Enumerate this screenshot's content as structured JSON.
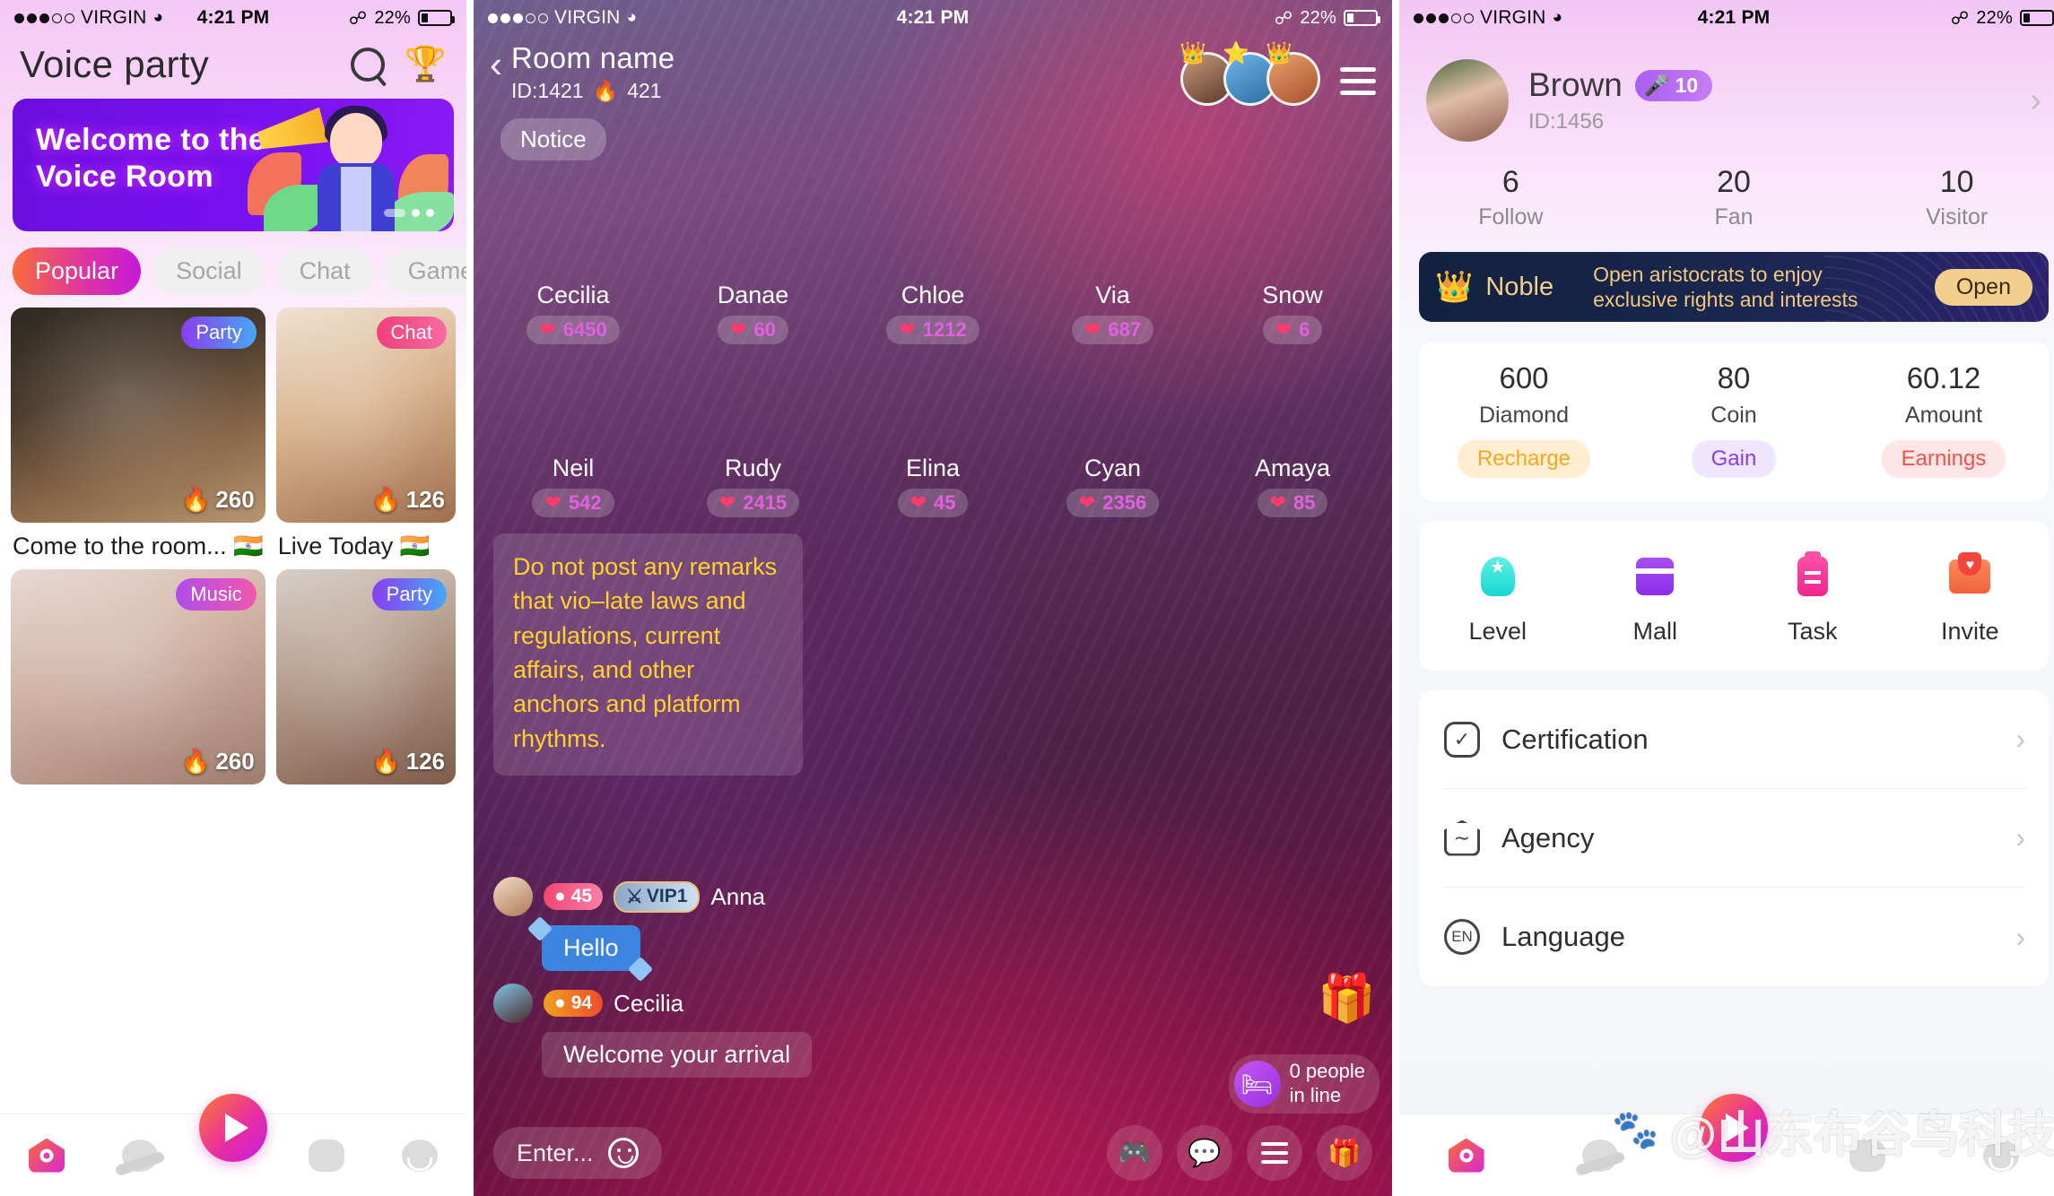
{
  "status_bar": {
    "carrier": "VIRGIN",
    "time": "4:21 PM",
    "battery": "22%"
  },
  "panel1": {
    "title": "Voice party",
    "icons": {
      "search": "search-icon",
      "trophy": "trophy-icon"
    },
    "banner": {
      "line1": "Welcome to the",
      "line2": "Voice Room"
    },
    "tabs": [
      {
        "label": "Popular",
        "active": true
      },
      {
        "label": "Social",
        "active": false
      },
      {
        "label": "Chat",
        "active": false
      },
      {
        "label": "Game",
        "active": false
      }
    ],
    "cards": [
      {
        "badge": "Party",
        "hot": "260",
        "title": "Come to the room... 🇮🇳"
      },
      {
        "badge": "Chat",
        "hot": "126",
        "title": "Live Today 🇮🇳"
      },
      {
        "badge": "Music",
        "hot": "260",
        "title": ""
      },
      {
        "badge": "Party",
        "hot": "126",
        "title": ""
      }
    ],
    "tabbar": [
      "home-icon",
      "planet-icon",
      "play-button",
      "message-icon",
      "profile-icon"
    ]
  },
  "panel2": {
    "room_name": "Room name",
    "room_id": "ID:1421",
    "room_heat": "421",
    "notice": "Notice",
    "seats": [
      {
        "name": "Cecilia",
        "love": "6450"
      },
      {
        "name": "Danae",
        "love": "60"
      },
      {
        "name": "Chloe",
        "love": "1212"
      },
      {
        "name": "Via",
        "love": "687"
      },
      {
        "name": "Snow",
        "love": "6"
      },
      {
        "name": "Neil",
        "love": "542"
      },
      {
        "name": "Rudy",
        "love": "2415"
      },
      {
        "name": "Elina",
        "love": "45"
      },
      {
        "name": "Cyan",
        "love": "2356"
      },
      {
        "name": "Amaya",
        "love": "85"
      }
    ],
    "rules": "Do not post any remarks that vio–late laws and regulations, current affairs, and other anchors and platform rhythms.",
    "messages": [
      {
        "level": "45",
        "vip": "VIP1",
        "user": "Anna",
        "text": "Hello"
      },
      {
        "level": "94",
        "vip": "",
        "user": "Cecilia",
        "text": "Welcome your arrival"
      }
    ],
    "queue": {
      "line1": "0 people",
      "line2": "in line"
    },
    "input_placeholder": "Enter...",
    "actions": [
      "game-icon",
      "chat-icon",
      "menu-icon",
      "gift-icon"
    ]
  },
  "panel3": {
    "profile": {
      "name": "Brown",
      "mic_level": "10",
      "id": "ID:1456"
    },
    "stats": [
      {
        "num": "6",
        "label": "Follow"
      },
      {
        "num": "20",
        "label": "Fan"
      },
      {
        "num": "10",
        "label": "Visitor"
      }
    ],
    "noble": {
      "label": "Noble",
      "desc_line1": "Open aristocrats to enjoy",
      "desc_line2": "exclusive rights and interests",
      "button": "Open"
    },
    "wallet": [
      {
        "num": "600",
        "label": "Diamond",
        "button": "Recharge"
      },
      {
        "num": "80",
        "label": "Coin",
        "button": "Gain"
      },
      {
        "num": "60.12",
        "label": "Amount",
        "button": "Earnings"
      }
    ],
    "menu4": [
      {
        "label": "Level",
        "icon": "rocket-icon"
      },
      {
        "label": "Mall",
        "icon": "shop-icon"
      },
      {
        "label": "Task",
        "icon": "clipboard-icon"
      },
      {
        "label": "Invite",
        "icon": "envelope-icon"
      }
    ],
    "list": [
      {
        "label": "Certification",
        "icon": "badge-check-icon"
      },
      {
        "label": "Agency",
        "icon": "agency-icon"
      },
      {
        "label": "Language",
        "icon": "language-icon",
        "badge": "EN"
      }
    ]
  },
  "watermark": {
    "text": "@山东布谷鸟科技"
  }
}
